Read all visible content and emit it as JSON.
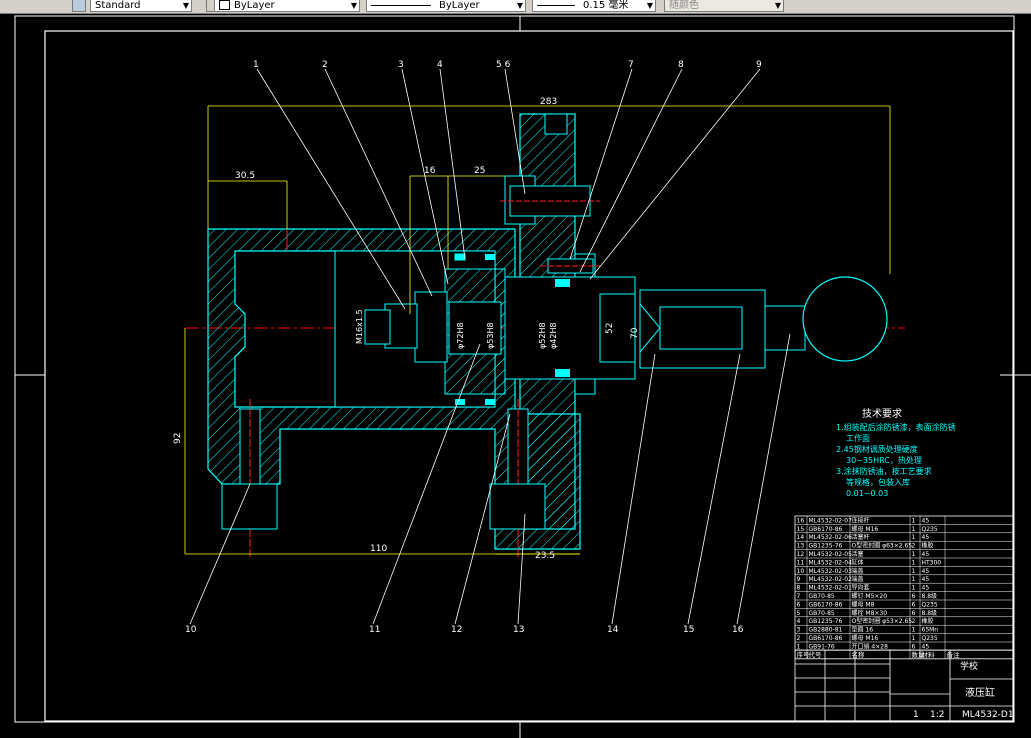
{
  "toolbar": {
    "text_style": "Standard",
    "color": "ByLayer",
    "linetype": "ByLayer",
    "lineweight": "0.15 毫米",
    "plotstyle": "随颜色"
  },
  "dimensions": {
    "d283": "283",
    "d30_5": "30.5",
    "d16": "16",
    "d25": "25",
    "d110": "110",
    "d23_5": "23.5",
    "d92": "92",
    "dM16x1_5": "M16x1.5",
    "dphi72": "φ72H8",
    "dphi53": "φ53H8",
    "dphi52": "φ52H8",
    "dphi42": "φ42H8",
    "d52": "52",
    "d70": "70"
  },
  "balloons_top": [
    "1",
    "2",
    "3",
    "4",
    "5 6",
    "7",
    "8",
    "9"
  ],
  "balloons_bottom": [
    "10",
    "11",
    "12",
    "13",
    "14",
    "15",
    "16"
  ],
  "tech": {
    "title": "技术要求",
    "l1": "1.组装配后涂防锈漆，表面涂防锈",
    "l2": "工作面",
    "l3": "2.45钢材调质处理硬度",
    "l4": "30~35HRC，热处理",
    "l5": "3.涂抹防锈油，按工艺要求",
    "l6": "等规格，包装入库",
    "l7": "0.01~0.03"
  },
  "bom": [
    [
      "16",
      "ML4532-02-07",
      "连接杆",
      "1",
      "45",
      ""
    ],
    [
      "15",
      "GB6170-86",
      "螺母 M16",
      "1",
      "Q235",
      ""
    ],
    [
      "14",
      "ML4532-02-06",
      "活塞杆",
      "1",
      "45",
      ""
    ],
    [
      "13",
      "GB1235-76",
      "O型密封圈 φ63×2.65",
      "2",
      "橡胶",
      ""
    ],
    [
      "12",
      "ML4532-02-05",
      "活塞",
      "1",
      "45",
      ""
    ],
    [
      "11",
      "ML4532-02-04",
      "缸体",
      "1",
      "HT300",
      ""
    ],
    [
      "10",
      "ML4532-02-03",
      "端盖",
      "1",
      "45",
      ""
    ],
    [
      "9",
      "ML4532-02-02",
      "端盖",
      "1",
      "45",
      ""
    ],
    [
      "8",
      "ML4532-02-01",
      "导向套",
      "1",
      "45",
      ""
    ],
    [
      "7",
      "GB70-85",
      "螺钉 M5×20",
      "6",
      "8.8级",
      ""
    ],
    [
      "6",
      "GB6170-86",
      "螺母 M8",
      "6",
      "Q235",
      ""
    ],
    [
      "5",
      "GB70-85",
      "螺栓 M8×30",
      "6",
      "8.8级",
      ""
    ],
    [
      "4",
      "GB1235-76",
      "O型密封圈 φ53×2.65",
      "2",
      "橡胶",
      ""
    ],
    [
      "3",
      "GB2880-81",
      "垫圈 16",
      "1",
      "65Mn",
      ""
    ],
    [
      "2",
      "GB6170-86",
      "螺母 M16",
      "1",
      "Q235",
      ""
    ],
    [
      "1",
      "GB91-76",
      "开口销 4×28",
      "6",
      "45",
      ""
    ]
  ],
  "title_block": {
    "org": "学校",
    "name": "液压缸",
    "code": "ML4532-D1",
    "scale": "1:2",
    "qty": "1",
    "col_no": "序号",
    "col_code": "代号",
    "col_name": "名称",
    "col_qty": "数量",
    "col_mat": "材料",
    "col_note": "备注"
  },
  "colors": {
    "outline": "#00ffff",
    "center": "#ff0000",
    "dim": "#ffff00",
    "frame": "#ffffff",
    "hatch": "#00ffff",
    "bolt": "#ff2020"
  }
}
